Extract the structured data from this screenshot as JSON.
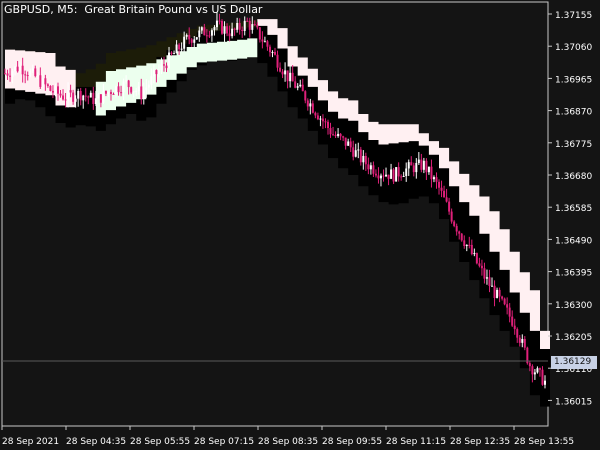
{
  "header": {
    "symbol": "GBPUSD",
    "timeframe": "M5",
    "description": "Great Britain Pound vs US Dollar",
    "title_text": "GBPUSD, M5:  Great Britain Pound vs US Dollar"
  },
  "current_price": "1.36129",
  "colors": {
    "background": "#141414",
    "axis": "#c8c8c8",
    "text": "#ffffff",
    "up_candle": "#ffffff",
    "down_candle": "#e0207a",
    "cloud_bear": "#fff0f2",
    "cloud_bull": "#ecffee",
    "cloud_dark": "#000000",
    "cloud_dark_olive": "#1c1c08",
    "price_line": "#5a5a5a",
    "price_tag_bg": "#c8d2e6"
  },
  "chart_data": {
    "type": "candlestick",
    "symbol": "GBPUSD",
    "timeframe": "M5",
    "y_ticks": [
      "1.37155",
      "1.37060",
      "1.36965",
      "1.36870",
      "1.36775",
      "1.36680",
      "1.36585",
      "1.36490",
      "1.36395",
      "1.36300",
      "1.36205",
      "1.36110",
      "1.36015"
    ],
    "x_ticks": [
      "28 Sep 2021",
      "28 Sep 04:35",
      "28 Sep 05:55",
      "28 Sep 07:15",
      "28 Sep 08:35",
      "28 Sep 09:55",
      "28 Sep 11:15",
      "28 Sep 12:35",
      "28 Sep 13:55"
    ],
    "ylim": [
      1.3596,
      1.3718
    ],
    "current_price": 1.36129,
    "close_path": [
      [
        0,
        1.3698
      ],
      [
        6,
        1.37
      ],
      [
        12,
        1.3697
      ],
      [
        18,
        1.3693
      ],
      [
        24,
        1.3691
      ],
      [
        30,
        1.3692
      ],
      [
        36,
        1.369
      ],
      [
        42,
        1.3693
      ],
      [
        48,
        1.3695
      ],
      [
        54,
        1.3692
      ],
      [
        60,
        1.3698
      ],
      [
        66,
        1.3703
      ],
      [
        72,
        1.3708
      ],
      [
        78,
        1.371
      ],
      [
        84,
        1.3712
      ],
      [
        90,
        1.371
      ],
      [
        96,
        1.3713
      ],
      [
        100,
        1.371
      ],
      [
        106,
        1.3704
      ],
      [
        112,
        1.3697
      ],
      [
        118,
        1.3692
      ],
      [
        124,
        1.3686
      ],
      [
        130,
        1.368
      ],
      [
        136,
        1.3677
      ],
      [
        142,
        1.3672
      ],
      [
        148,
        1.3669
      ],
      [
        154,
        1.3668
      ],
      [
        160,
        1.367
      ],
      [
        166,
        1.3671
      ],
      [
        172,
        1.3664
      ],
      [
        178,
        1.3654
      ],
      [
        184,
        1.3646
      ],
      [
        190,
        1.3638
      ],
      [
        196,
        1.3631
      ],
      [
        202,
        1.3624
      ],
      [
        208,
        1.3612
      ],
      [
        214,
        1.3607
      ]
    ],
    "bands": [
      {
        "name": "cloud_bear",
        "upper": [
          [
            0,
            1.3705
          ],
          [
            16,
            1.3704
          ],
          [
            20,
            1.37
          ],
          [
            28,
            1.3698
          ],
          [
            35,
            1.37
          ],
          [
            40,
            1.3704
          ],
          [
            55,
            1.3706
          ],
          [
            62,
            1.3708
          ],
          [
            75,
            1.3712
          ],
          [
            90,
            1.3713
          ],
          [
            100,
            1.3714
          ],
          [
            106,
            1.3714
          ],
          [
            112,
            1.3706
          ],
          [
            118,
            1.3701
          ],
          [
            124,
            1.3696
          ],
          [
            130,
            1.3691
          ],
          [
            136,
            1.369
          ],
          [
            142,
            1.3684
          ],
          [
            148,
            1.3683
          ],
          [
            160,
            1.3683
          ],
          [
            166,
            1.3679
          ],
          [
            172,
            1.3676
          ],
          [
            178,
            1.367
          ],
          [
            184,
            1.3665
          ],
          [
            190,
            1.366
          ],
          [
            196,
            1.3652
          ],
          [
            202,
            1.3642
          ],
          [
            208,
            1.3634
          ],
          [
            214,
            1.3616
          ]
        ],
        "lower": [
          [
            0,
            1.37
          ],
          [
            16,
            1.3698
          ],
          [
            20,
            1.3695
          ],
          [
            28,
            1.3694
          ],
          [
            35,
            1.3694
          ],
          [
            40,
            1.3696
          ],
          [
            55,
            1.37
          ],
          [
            62,
            1.3704
          ],
          [
            75,
            1.371
          ],
          [
            90,
            1.3711
          ],
          [
            100,
            1.3712
          ],
          [
            106,
            1.3708
          ],
          [
            112,
            1.37
          ],
          [
            118,
            1.3696
          ],
          [
            124,
            1.369
          ],
          [
            130,
            1.3685
          ],
          [
            136,
            1.3684
          ],
          [
            142,
            1.3679
          ],
          [
            148,
            1.3677
          ],
          [
            160,
            1.3678
          ],
          [
            166,
            1.3676
          ],
          [
            172,
            1.367
          ],
          [
            178,
            1.3662
          ],
          [
            184,
            1.3656
          ],
          [
            190,
            1.3648
          ],
          [
            196,
            1.364
          ],
          [
            202,
            1.363
          ],
          [
            208,
            1.3622
          ],
          [
            214,
            1.3614
          ]
        ]
      }
    ]
  }
}
